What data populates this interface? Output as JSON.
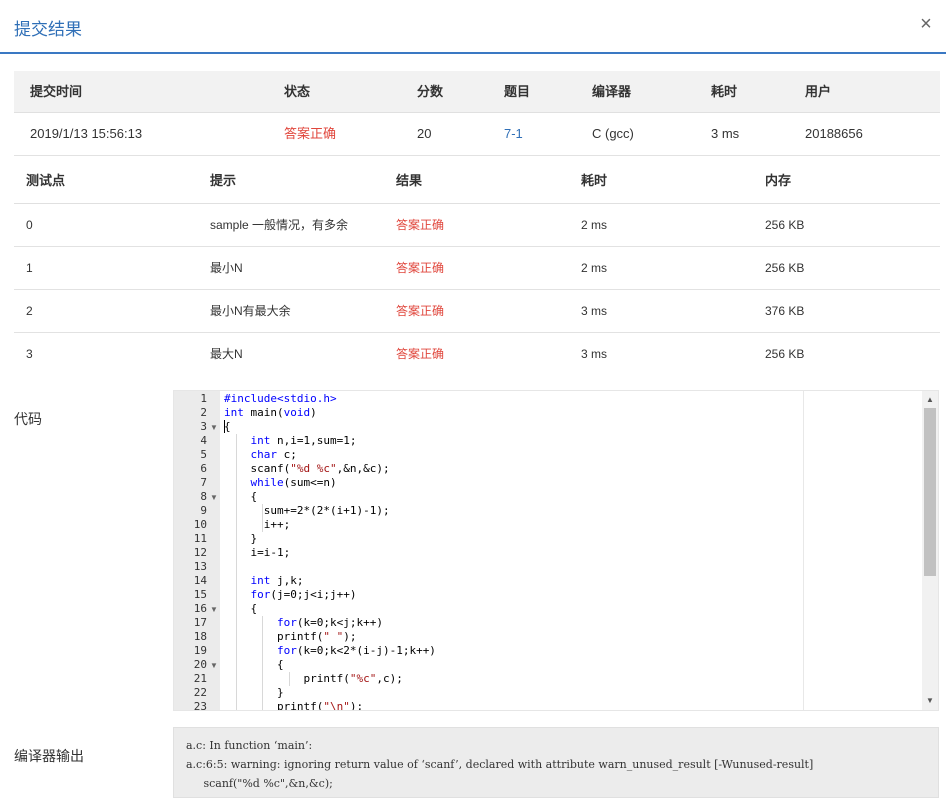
{
  "dialog": {
    "title": "提交结果",
    "close": "×"
  },
  "summary": {
    "headers": [
      "提交时间",
      "状态",
      "分数",
      "题目",
      "编译器",
      "耗时",
      "用户"
    ],
    "row": [
      "2019/1/13 15:56:13",
      "答案正确",
      "20",
      "7-1",
      "C (gcc)",
      "3 ms",
      "20188656"
    ]
  },
  "tests": {
    "headers": [
      "测试点",
      "提示",
      "结果",
      "耗时",
      "内存"
    ],
    "rows": [
      [
        "0",
        "sample 一般情况，有多余",
        "答案正确",
        "2 ms",
        "256 KB"
      ],
      [
        "1",
        "最小N",
        "答案正确",
        "2 ms",
        "256 KB"
      ],
      [
        "2",
        "最小N有最大余",
        "答案正确",
        "3 ms",
        "376 KB"
      ],
      [
        "3",
        "最大N",
        "答案正确",
        "3 ms",
        "256 KB"
      ]
    ]
  },
  "code_label": "代码",
  "code_lines": [
    "#include<stdio.h>",
    "int main(void)",
    "{",
    "    int n,i=1,sum=1;",
    "    char c;",
    "    scanf(\"%d %c\",&n,&c);",
    "    while(sum<=n)",
    "    {",
    "      sum+=2*(2*(i+1)-1);",
    "      i++;",
    "    }",
    "    i=i-1;",
    "",
    "    int j,k;",
    "    for(j=0;j<i;j++)",
    "    {",
    "        for(k=0;k<j;k++)",
    "        printf(\" \");",
    "        for(k=0;k<2*(i-j)-1;k++)",
    "        {",
    "            printf(\"%c\",c);",
    "        }",
    "        printf(\"\\n\");"
  ],
  "compiler_label": "编译器输出",
  "compiler_output": [
    "a.c: In function ‘main’:",
    "a.c:6:5: warning: ignoring return value of ‘scanf’, declared with attribute warn_unused_result [-Wunused-result]",
    "     scanf(\"%d %c\",&n,&c);",
    "     ^~~~~~~~~~~~~~~~~~~~~~"
  ],
  "colors": {
    "accent": "#2f6fb7",
    "accepted": "#e0463c"
  },
  "icons": {
    "close": "close-icon",
    "fold": "fold-arrow-icon"
  }
}
